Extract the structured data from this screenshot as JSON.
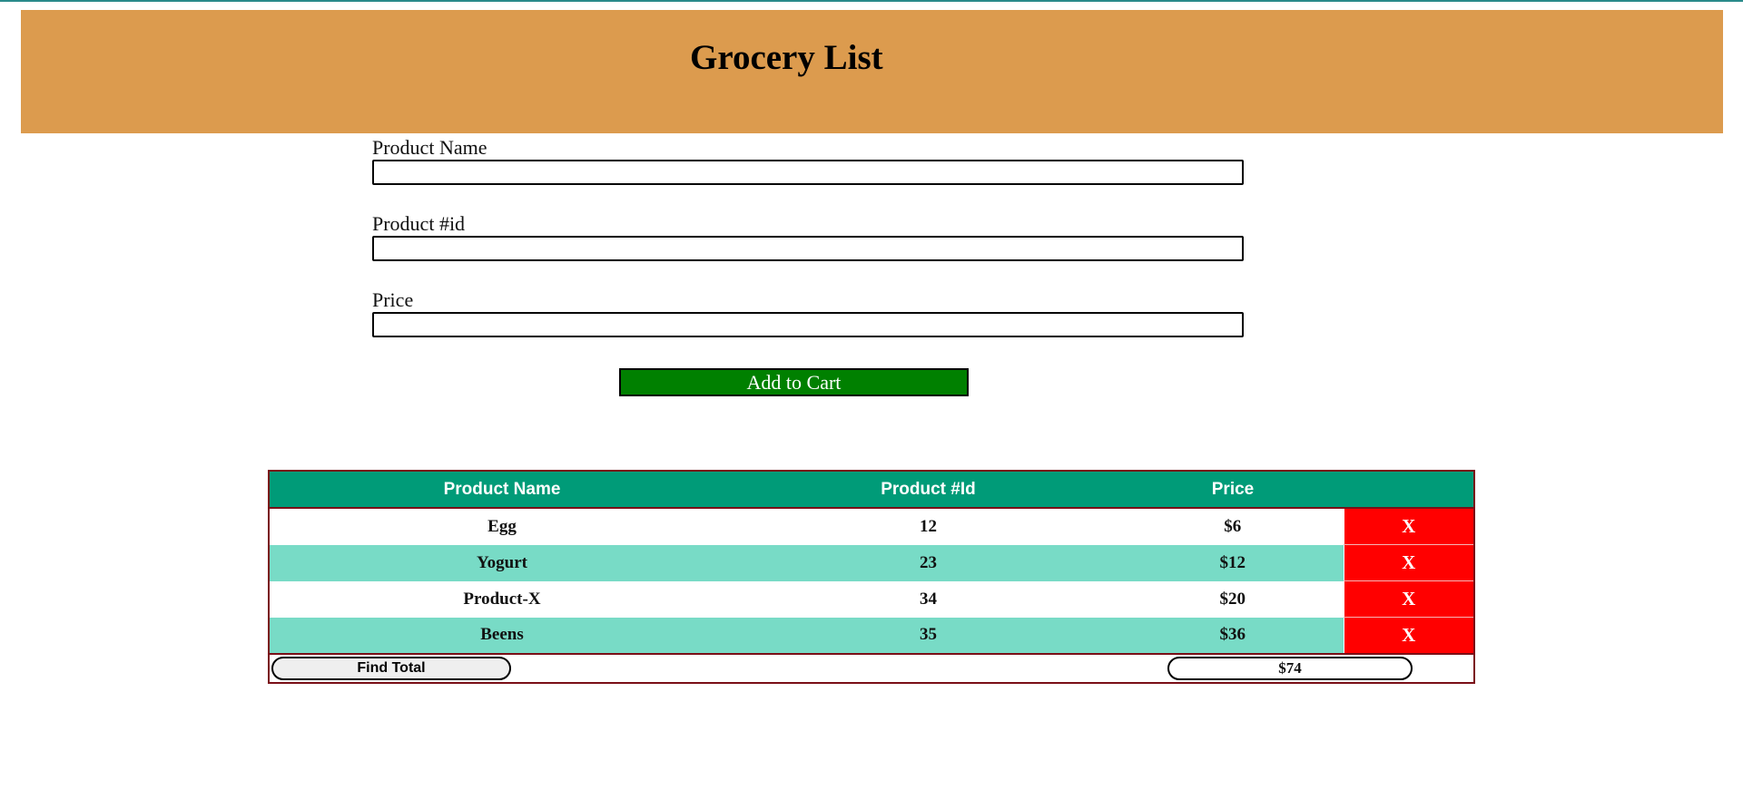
{
  "header": {
    "title": "Grocery List"
  },
  "form": {
    "name_label": "Product Name",
    "name_value": "",
    "id_label": "Product #id",
    "id_value": "",
    "price_label": "Price",
    "price_value": "",
    "add_button_label": "Add to Cart"
  },
  "cart": {
    "columns": [
      "Product Name",
      "Product #Id",
      "Price",
      ""
    ],
    "rows": [
      {
        "name": "Egg",
        "id": "12",
        "price": "$6",
        "delete": "X"
      },
      {
        "name": "Yogurt",
        "id": "23",
        "price": "$12",
        "delete": "X"
      },
      {
        "name": "Product-X",
        "id": "34",
        "price": "$20",
        "delete": "X"
      },
      {
        "name": "Beens",
        "id": "35",
        "price": "$36",
        "delete": "X"
      }
    ],
    "find_total_label": "Find Total",
    "total_value": "$74"
  },
  "colors": {
    "header_bg": "#dc9b4e",
    "table_header_bg": "#009b78",
    "row_alt_bg": "#78dbc6",
    "delete_bg": "#ff0000",
    "add_button_bg": "#008000",
    "table_border": "#7a0f17"
  }
}
